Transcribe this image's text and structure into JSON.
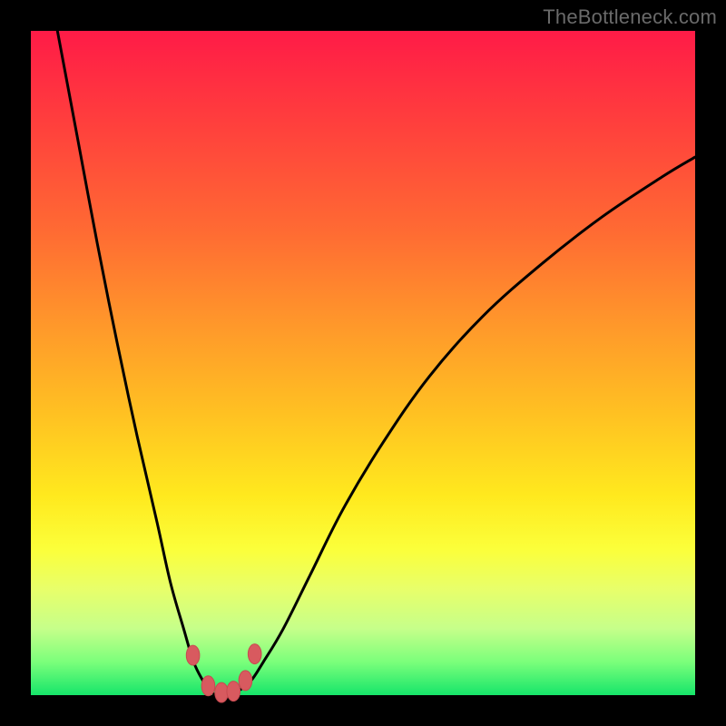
{
  "watermark": {
    "text": "TheBottleneck.com"
  },
  "colors": {
    "frame": "#000000",
    "gradient_top": "#ff1b47",
    "gradient_mid1": "#ff9a2a",
    "gradient_mid2": "#ffe91e",
    "gradient_bottom": "#16e56a",
    "curve": "#000000",
    "marker_fill": "#d85a5f",
    "marker_stroke": "#c74a50"
  },
  "chart_data": {
    "type": "line",
    "title": "",
    "xlabel": "",
    "ylabel": "",
    "x_range": [
      0,
      100
    ],
    "y_range": [
      0,
      100
    ],
    "curve_left": {
      "description": "steep left branch falling from top-left into the trough",
      "x": [
        4,
        7,
        10,
        13,
        16,
        19,
        21,
        23,
        24.5,
        26,
        27,
        28
      ],
      "y": [
        100,
        84,
        68,
        53,
        39,
        26,
        17,
        10,
        5,
        2,
        0.5,
        0
      ]
    },
    "curve_right": {
      "description": "right branch rising from trough, decelerating toward top-right",
      "x": [
        30,
        31,
        33,
        35,
        38,
        42,
        47,
        53,
        60,
        68,
        77,
        86,
        95,
        100
      ],
      "y": [
        0,
        0.5,
        2,
        5,
        10,
        18,
        28,
        38,
        48,
        57,
        65,
        72,
        78,
        81
      ]
    },
    "trough": {
      "x_center": 29,
      "y": 0,
      "flat_width": 3
    },
    "markers": {
      "description": "small rounded red markers near the trough on both branches",
      "points": [
        {
          "x": 24.4,
          "y": 6.0
        },
        {
          "x": 26.7,
          "y": 1.4
        },
        {
          "x": 28.7,
          "y": 0.4
        },
        {
          "x": 30.5,
          "y": 0.6
        },
        {
          "x": 32.3,
          "y": 2.2
        },
        {
          "x": 33.7,
          "y": 6.2
        }
      ],
      "rx": 1.0,
      "ry": 1.5
    }
  }
}
